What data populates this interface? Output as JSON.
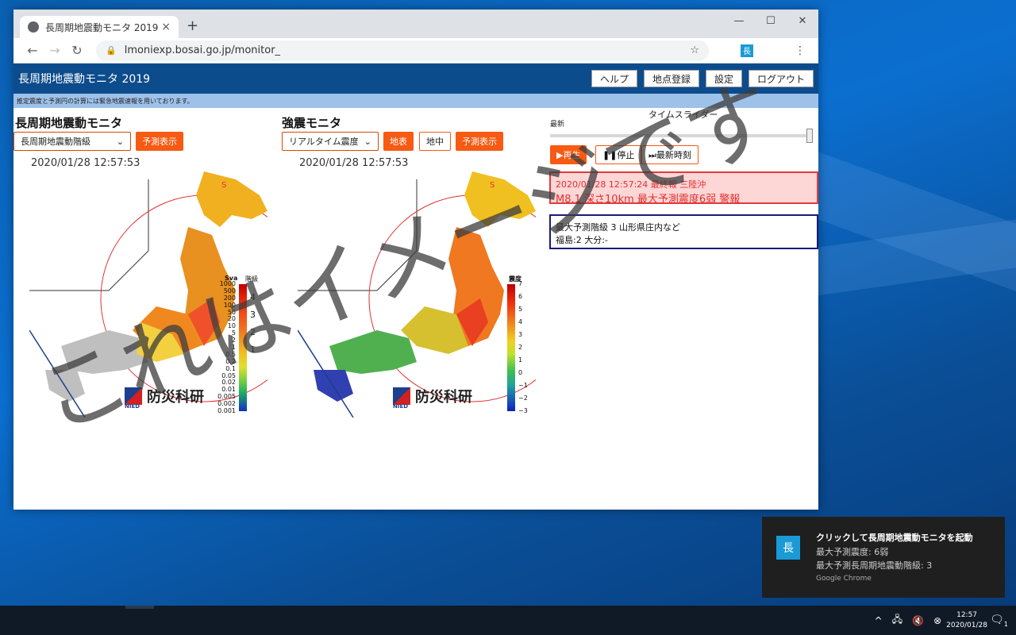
{
  "browser": {
    "tab_title": "長周期地震動モニタ 2019",
    "url": "lmoniexp.bosai.go.jp/monitor_",
    "new_tab": "+",
    "minimize": "—",
    "maximize": "☐",
    "close": "✕"
  },
  "app": {
    "title": "長周期地震動モニタ 2019",
    "buttons": {
      "help": "ヘルプ",
      "register": "地点登録",
      "settings": "設定",
      "logout": "ログアウト"
    },
    "notice": "推定震度と予測円の計算には緊急地震速報を用いております。"
  },
  "left_panel": {
    "title": "長周期地震動モニタ",
    "select": "長周期地震動階級",
    "predict_btn": "予測表示",
    "timestamp": "2020/01/28 12:57:53",
    "scale_header_sva": "Sva",
    "scale_header_class": "階級",
    "sva_ticks": [
      "1000",
      "500",
      "200",
      "100",
      "50",
      "20",
      "10",
      "5",
      "2",
      "1",
      "0.5",
      "0.2",
      "0.1",
      "0.05",
      "0.02",
      "0.01",
      "0.005",
      "0.002",
      "0.001"
    ],
    "class_ticks": [
      "4",
      "3",
      "2",
      "1"
    ],
    "logo_text": "防災科研",
    "logo_sub": "NIED",
    "epicenter_mark": "S"
  },
  "right_panel": {
    "title": "強震モニタ",
    "select": "リアルタイム震度",
    "surface_btn": "地表",
    "underground_btn": "地中",
    "predict_btn": "予測表示",
    "timestamp": "2020/01/28 12:57:53",
    "scale_header": "震度",
    "scale_ticks": [
      "7",
      "6",
      "5",
      "4",
      "3",
      "2",
      "1",
      "0",
      "−1",
      "−2",
      "−3"
    ],
    "logo_text": "防災科研",
    "logo_sub": "NIED",
    "epicenter_mark": "S"
  },
  "time_slider": {
    "title": "タイムスライダー",
    "latest_label": "最新",
    "play": "▶再生",
    "stop": "❚❚停止",
    "latest_time": "⏭最新時刻"
  },
  "eew": {
    "line1": "2020/01/28 12:57:24 最終報 三陸沖",
    "line2": "M8.1 深さ10km 最大予測震度6弱 警報"
  },
  "prediction": {
    "line1": "最大予測階級 3 山形県庄内など",
    "line2": "福島:2 大分:-"
  },
  "watermark": "これはイメージです",
  "toast": {
    "title": "クリックして長周期地震動モニタを起動",
    "line1": "最大予測震度: 6弱",
    "line2": "最大予測長周期地震動階級: 3",
    "source": "Google Chrome",
    "icon": "長"
  },
  "taskbar": {
    "time": "12:57",
    "date": "2020/01/28",
    "chevron": "^",
    "notif_count": "1"
  },
  "colors": {
    "header": "#0d4c8c",
    "accent": "#f75a12",
    "eew_bg": "#fdd6d6",
    "eew_border": "#e13b3b"
  }
}
